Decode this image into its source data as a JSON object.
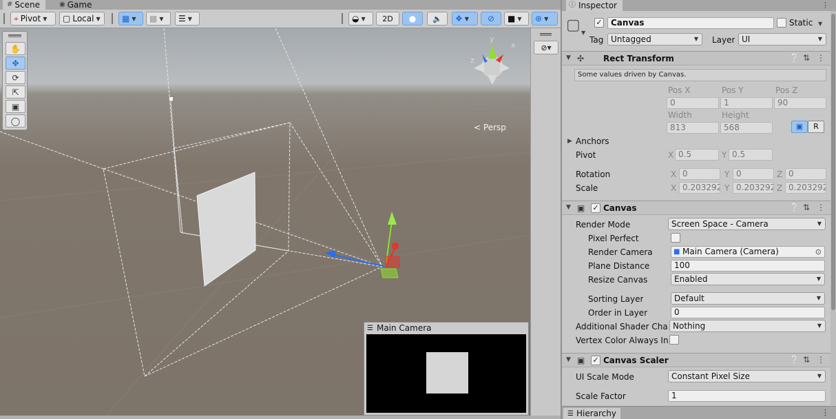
{
  "scene_tabs": {
    "scene": "Scene",
    "game": "Game"
  },
  "toolbar": {
    "pivot": "Pivot",
    "local": "Local",
    "two_d": "2D"
  },
  "viewport": {
    "persp": "Persp",
    "gizmo_axes": {
      "x": "x",
      "y": "y",
      "z": "z"
    }
  },
  "camera_preview": {
    "title": "Main Camera"
  },
  "inspector": {
    "tab": "Inspector",
    "object": {
      "name": "Canvas",
      "static_label": "Static",
      "tag_label": "Tag",
      "tag_value": "Untagged",
      "layer_label": "Layer",
      "layer_value": "UI"
    },
    "rect_transform": {
      "title": "Rect Transform",
      "info": "Some values driven by Canvas.",
      "pos_x_label": "Pos X",
      "pos_y_label": "Pos Y",
      "pos_z_label": "Pos Z",
      "pos_x": "0",
      "pos_y": "1",
      "pos_z": "90",
      "width_label": "Width",
      "height_label": "Height",
      "width": "813",
      "height": "568",
      "r_button": "R",
      "anchors_label": "Anchors",
      "pivot_label": "Pivot",
      "pivot_x": "0.5",
      "pivot_y": "0.5",
      "rotation_label": "Rotation",
      "rot_x": "0",
      "rot_y": "0",
      "rot_z": "0",
      "scale_label": "Scale",
      "scale_x": "0.203292",
      "scale_y": "0.203292",
      "scale_z": "0.203292",
      "x": "X",
      "y": "Y",
      "z": "Z"
    },
    "canvas": {
      "title": "Canvas",
      "render_mode_label": "Render Mode",
      "render_mode": "Screen Space - Camera",
      "pixel_perfect_label": "Pixel Perfect",
      "render_camera_label": "Render Camera",
      "render_camera": "Main Camera (Camera)",
      "plane_distance_label": "Plane Distance",
      "plane_distance": "100",
      "resize_canvas_label": "Resize Canvas",
      "resize_canvas": "Enabled",
      "sorting_layer_label": "Sorting Layer",
      "sorting_layer": "Default",
      "order_in_layer_label": "Order in Layer",
      "order_in_layer": "0",
      "additional_shader_label": "Additional Shader Chann",
      "additional_shader": "Nothing",
      "vertex_color_label": "Vertex Color Always In G"
    },
    "canvas_scaler": {
      "title": "Canvas Scaler",
      "ui_scale_mode_label": "UI Scale Mode",
      "ui_scale_mode": "Constant Pixel Size",
      "scale_factor_label": "Scale Factor",
      "scale_factor": "1"
    }
  },
  "hierarchy": {
    "tab": "Hierarchy"
  },
  "colors": {
    "accent": "#9ac3f0",
    "gizmo_y": "#8ee02a",
    "gizmo_x": "#e8342a",
    "gizmo_z": "#2a6ef0"
  }
}
